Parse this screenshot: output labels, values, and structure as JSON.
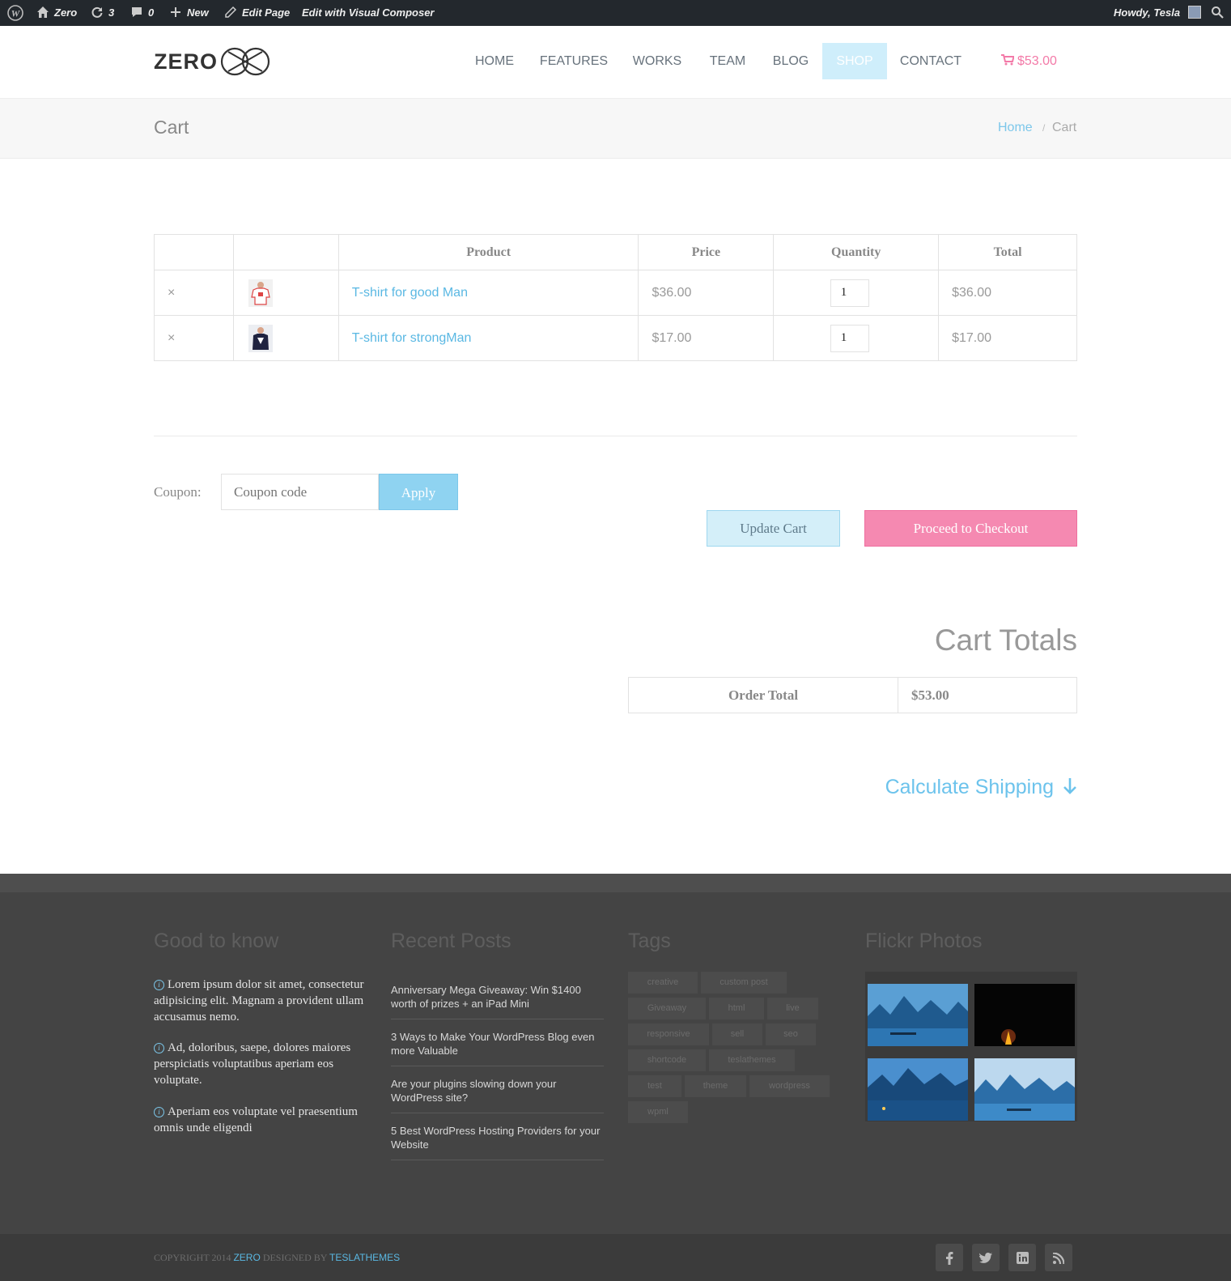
{
  "adminbar": {
    "site": "Zero",
    "updates": "3",
    "comments": "0",
    "new_label": "New",
    "edit_label": "Edit Page",
    "vc_label": "Edit with Visual Composer",
    "howdy": "Howdy, Tesla"
  },
  "header": {
    "logo": "ZERO",
    "nav": [
      "HOME",
      "FEATURES",
      "WORKS",
      "TEAM",
      "BLOG",
      "SHOP",
      "CONTACT"
    ],
    "active_nav": "SHOP",
    "cart_total": "$53.00"
  },
  "titlebar": {
    "title": "Cart",
    "breadcrumb": {
      "home": "Home",
      "sep": "/",
      "current": "Cart"
    }
  },
  "cart": {
    "headers": [
      "",
      "",
      "Product",
      "Price",
      "Quantity",
      "Total"
    ],
    "rows": [
      {
        "remove": "×",
        "product": "T-shirt for good Man",
        "price": "$36.00",
        "qty": "1",
        "total": "$36.00"
      },
      {
        "remove": "×",
        "product": "T-shirt for strongMan",
        "price": "$17.00",
        "qty": "1",
        "total": "$17.00"
      }
    ],
    "coupon_label": "Coupon:",
    "coupon_placeholder": "Coupon code",
    "apply_label": "Apply",
    "update_label": "Update Cart",
    "checkout_label": "Proceed to Checkout"
  },
  "totals": {
    "title": "Cart Totals",
    "order_total_label": "Order Total",
    "order_total_value": "$53.00",
    "shipping_link": "Calculate Shipping"
  },
  "footer": {
    "good_to_know": {
      "title": "Good to know",
      "items": [
        "Lorem ipsum dolor sit amet, consectetur adipisicing elit. Magnam a provident ullam accusamus nemo.",
        "Ad, doloribus, saepe, dolores maiores perspiciatis voluptatibus aperiam eos voluptate.",
        "Aperiam eos voluptate vel praesentium omnis unde eligendi"
      ]
    },
    "recent_posts": {
      "title": "Recent Posts",
      "items": [
        "Anniversary Mega Giveaway: Win $1400 worth of prizes + an iPad Mini",
        "3 Ways to Make Your WordPress Blog even more Valuable",
        "Are your plugins slowing down your WordPress site?",
        "5 Best WordPress Hosting Providers for your Website"
      ]
    },
    "tags": {
      "title": "Tags",
      "items": [
        "creative",
        "custom post",
        "Giveaway",
        "html",
        "live",
        "responsive",
        "sell",
        "seo",
        "shortcode",
        "teslathemes",
        "test",
        "theme",
        "wordpress",
        "wpml"
      ]
    },
    "flickr": {
      "title": "Flickr Photos"
    },
    "copyright": {
      "prefix": "COPYRIGHT 2014",
      "brand": "ZERO",
      "designed": "DESIGNED BY",
      "author": "TESLATHEMES"
    },
    "social": [
      "f",
      "t",
      "in",
      "rss"
    ]
  },
  "colors": {
    "accent": "#7cc7ea",
    "pink": "#f589b1",
    "adminbar": "#23282d",
    "footer": "#444444"
  }
}
